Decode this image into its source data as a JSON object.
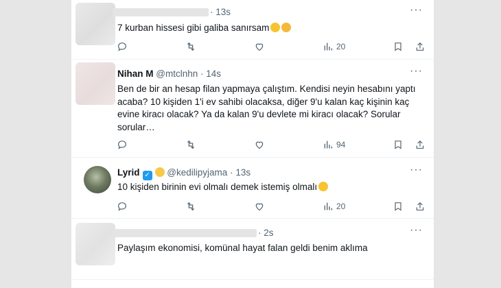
{
  "tweets": [
    {
      "id": "t1",
      "name": "",
      "handle": "",
      "time": "13s",
      "text": "7 kurban hissesi gibi galiba sanırsam",
      "views": "20"
    },
    {
      "id": "t2",
      "name": "Nihan M",
      "handle": "@mtclnhn",
      "time": "14s",
      "text_lines": [
        "Ben de bir an hesap filan yapmaya çalıştım. Kendisi neyin hesabını yaptı",
        "acaba? 10 kişiden 1'i ev sahibi olacaksa, diğer 9'u kalan kaç kişinin kaç",
        "evine kiracı olacak? Ya da kalan 9'u devlete mi kiracı olacak? Sorular",
        "sorular…"
      ],
      "views": "94"
    },
    {
      "id": "t3",
      "name": "Lyrid",
      "handle": "@kedilipyjama",
      "time": "13s",
      "text": "10 kişiden birinin evi olmalı demek istemiş olmalı",
      "views": "20"
    },
    {
      "id": "t4",
      "name": "",
      "handle": "",
      "time": "2s",
      "text": "Paylaşım ekonomisi, komünal hayat falan geldi benim aklıma"
    }
  ],
  "separator": "·",
  "more_glyph": "···",
  "icons": [
    "reply-icon",
    "retweet-icon",
    "like-icon",
    "views-icon",
    "bookmark-icon",
    "share-icon",
    "more-icon"
  ],
  "colors": {
    "text": "#0f1419",
    "muted": "#536471",
    "frame": "#e6e6e6",
    "divider": "#eff3f4",
    "verified": "#1d9bf0"
  }
}
